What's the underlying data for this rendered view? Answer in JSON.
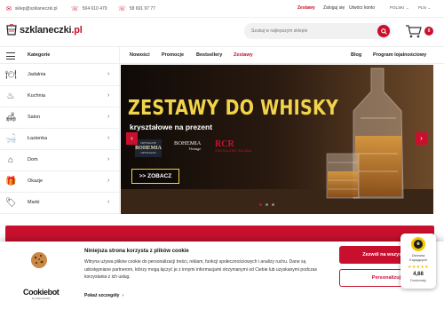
{
  "topbar": {
    "email": "sklep@szklaneczki.pl",
    "phone1": "504 610 479",
    "phone2": "58 691 97 77",
    "links": {
      "zestawy": "Zestawy",
      "zaloguj": "Zaloguj się",
      "utworz": "Utwórz konto"
    },
    "language": "POLSKI",
    "currency": "PLN"
  },
  "header": {
    "logo_main": "szklaneczki",
    "logo_suffix": ".pl",
    "search_placeholder": "Szukaj w najlepszym sklepie",
    "cart_count": "0"
  },
  "nav": {
    "categories_label": "Kategorie",
    "links": [
      "Nowości",
      "Promocje",
      "Bestsellery",
      "Zestawy",
      "Blog",
      "Program lojalnościowy"
    ]
  },
  "sidebar": {
    "items": [
      {
        "label": "Jadalnia",
        "icon": "dining-icon"
      },
      {
        "label": "Kuchnia",
        "icon": "kitchen-icon"
      },
      {
        "label": "Salon",
        "icon": "sofa-icon"
      },
      {
        "label": "Łazienka",
        "icon": "bath-icon"
      },
      {
        "label": "Dom",
        "icon": "home-icon"
      },
      {
        "label": "Okazje",
        "icon": "gift-icon"
      },
      {
        "label": "Marki",
        "icon": "tag-icon"
      }
    ]
  },
  "banner": {
    "title": "ZESTAWY DO WHISKY",
    "subtitle": "kryształowe na prezent",
    "brand1_top": "CRYSTALITE",
    "brand1_main": "BOHEMIA",
    "brand1_sub": "CRYSTALEX",
    "brand2_main": "BOHEMIA",
    "brand2_sub": "Vintage",
    "brand3_main": "RCR",
    "brand3_sub": "CRISTALLERIE ITALIANA",
    "cta": ">> ZOBACZ",
    "prev": "‹",
    "next": "›",
    "slides": 3,
    "active_slide": 0
  },
  "cookie": {
    "title": "Niniejsza strona korzysta z plików cookie",
    "body": "Witryna używa plików cookie do personalizacji treści, reklam, funkcji społecznościowych i analizy ruchu. Dane są udostępniane partnerom, którzy mogą łączyć je z innymi informacjami otrzymanymi od Ciebie lub uzyskanymi podczas korzystania z ich usług.",
    "details": "Pokaż szczegóły",
    "accept": "Zezwól na wszystkie",
    "personalize": "Personalizuj",
    "brand": "Cookiebot",
    "brand_sub": "by Usercentrics"
  },
  "trust": {
    "line1": "Ochrona",
    "line2": "Kupujących",
    "stars": "★★★★★",
    "score": "4,68",
    "rating": "Doskonały"
  },
  "colors": {
    "accent": "#c8102e",
    "gold": "#f2d44a"
  }
}
